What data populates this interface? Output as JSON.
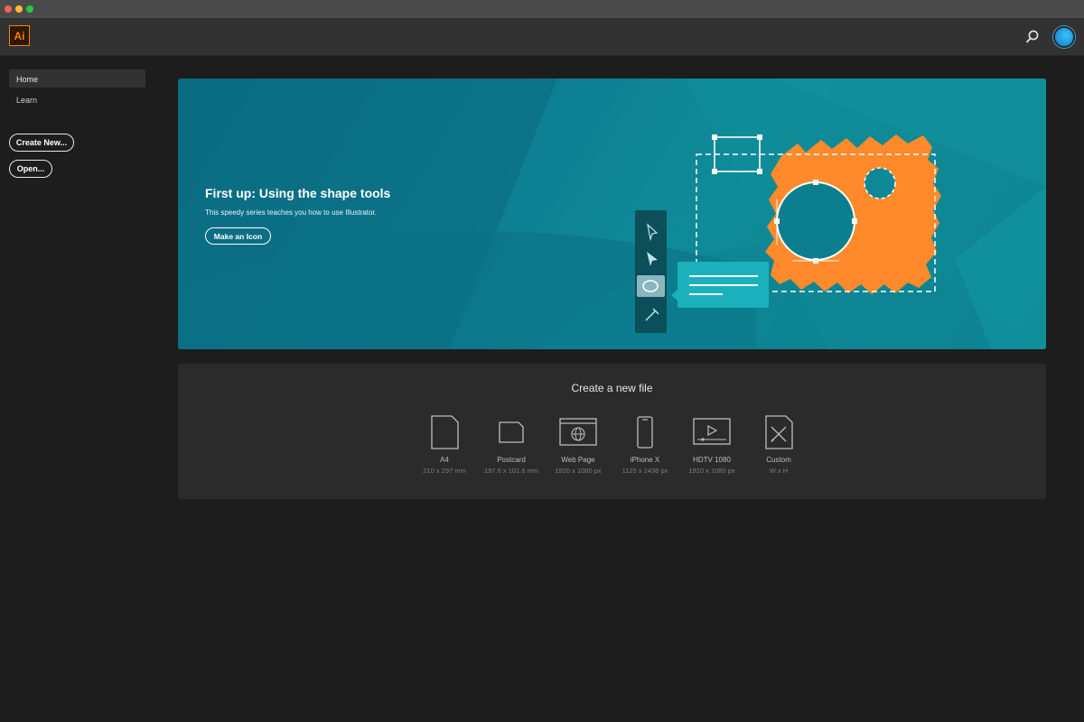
{
  "app": {
    "logo_text": "Ai",
    "accent": "#ff7c00"
  },
  "header": {
    "search_icon": "search-icon",
    "avatar": "user-avatar"
  },
  "sidebar": {
    "items": [
      {
        "label": "Home",
        "active": true
      },
      {
        "label": "Learn",
        "active": false
      }
    ],
    "create_new_label": "Create New...",
    "open_label": "Open..."
  },
  "hero": {
    "title": "First up: Using the shape tools",
    "subtitle": "This speedy series teaches you how to use Illustrator.",
    "button_label": "Make an Icon",
    "tools": [
      "selection-tool-icon",
      "direct-selection-tool-icon",
      "ellipse-tool-icon",
      "eyedropper-tool-icon"
    ],
    "colors": {
      "teal": "#0e7e92",
      "orange": "#ff8a2b",
      "panel": "#0a4f5a"
    }
  },
  "new_file": {
    "title": "Create a new file",
    "presets": [
      {
        "name": "A4",
        "size": "210 x 297 mm",
        "icon": "document-icon"
      },
      {
        "name": "Postcard",
        "size": "197.6 x 101.6 mm",
        "icon": "postcard-icon"
      },
      {
        "name": "Web Page",
        "size": "1920 x 1080 px",
        "icon": "web-page-icon"
      },
      {
        "name": "iPhone X",
        "size": "1125 x 2436 px",
        "icon": "phone-icon"
      },
      {
        "name": "HDTV 1080",
        "size": "1920 x 1080 px",
        "icon": "hdtv-icon"
      },
      {
        "name": "Custom",
        "size": "W x H",
        "icon": "custom-icon"
      }
    ]
  }
}
